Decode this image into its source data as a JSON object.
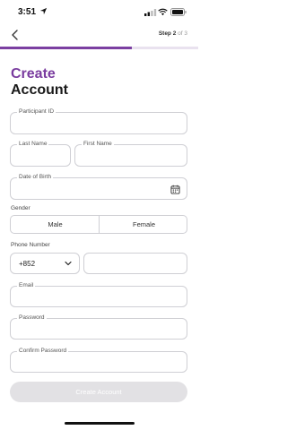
{
  "status_bar": {
    "time": "3:51"
  },
  "header": {
    "step_prefix": "Step",
    "step_current": "2",
    "step_suffix": "of 3",
    "progress_fraction": 0.667
  },
  "title": {
    "line1": "Create",
    "line2": "Account"
  },
  "fields": {
    "participant_id": {
      "label": "Participant ID",
      "value": ""
    },
    "last_name": {
      "label": "Last Name",
      "value": ""
    },
    "first_name": {
      "label": "First Name",
      "value": ""
    },
    "date_of_birth": {
      "label": "Date of Birth",
      "value": ""
    },
    "email": {
      "label": "Email",
      "value": ""
    },
    "password": {
      "label": "Password",
      "value": ""
    },
    "confirm_password": {
      "label": "Confirm Password",
      "value": ""
    }
  },
  "gender": {
    "label": "Gender",
    "options": [
      "Male",
      "Female"
    ]
  },
  "phone": {
    "label": "Phone Number",
    "country_code": "+852",
    "number": ""
  },
  "submit": {
    "label": "Create Account",
    "enabled": false
  },
  "colors": {
    "accent": "#7b3fa1",
    "title_purple": "#7a3c9f",
    "disabled_button": "#e2e1e4"
  },
  "icons": [
    "location-arrow-icon",
    "cellular-signal-icon",
    "wifi-icon",
    "battery-icon",
    "back-chevron-icon",
    "calendar-icon",
    "chevron-down-icon"
  ]
}
